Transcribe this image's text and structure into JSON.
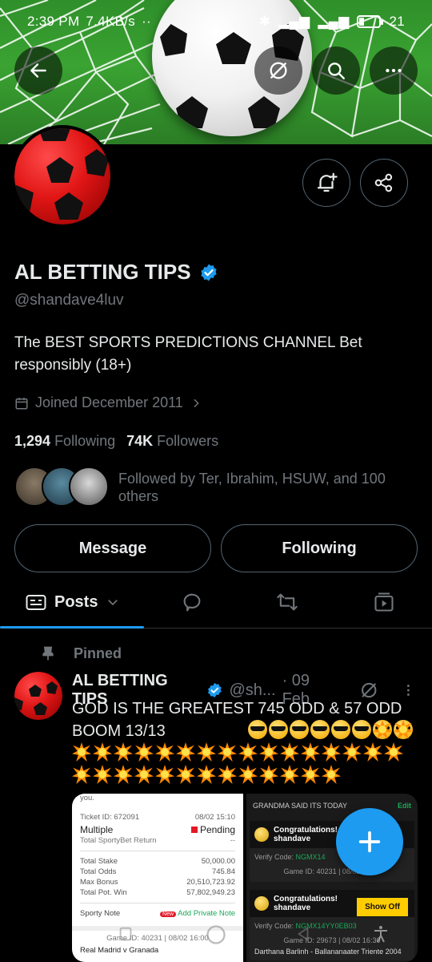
{
  "status_bar": {
    "time": "2:39 PM",
    "speed": "7.4KB/s",
    "battery": "21"
  },
  "profile": {
    "display_name": "AL BETTING TIPS",
    "handle": "@shandave4luv",
    "bio": "The BEST SPORTS PREDICTIONS CHANNEL Bet responsibly (18+)",
    "joined": "Joined December 2011",
    "following_count": "1,294",
    "following_label": "Following",
    "followers_count": "74K",
    "followers_label": "Followers",
    "followed_by": "Followed by Ter, Ibrahim, HSUW, and 100 others"
  },
  "actions": {
    "message_label": "Message",
    "following_label": "Following"
  },
  "tabs": {
    "posts_label": "Posts"
  },
  "post": {
    "pinned_label": "Pinned",
    "author": "AL BETTING TIPS",
    "handle": "@sh...",
    "date": "· 09 Feb",
    "text": "GOD IS THE GREATEST 745 ODD & 57 ODD BOOM 13/13"
  },
  "receipt": {
    "top_text": "you.",
    "ticket_id": "Ticket ID: 672091",
    "ticket_time": "08/02 15:10",
    "bet_type": "Multiple",
    "status": "Pending",
    "return_label": "Total SportyBet Return",
    "return_value": "--",
    "stake_label": "Total Stake",
    "stake_value": "50,000.00",
    "odds_label": "Total Odds",
    "odds_value": "745.84",
    "bonus_label": "Max Bonus",
    "bonus_value": "20,510,723.92",
    "potwin_label": "Total Pot. Win",
    "potwin_value": "57,802,949.23",
    "note_label": "Sporty Note",
    "new_badge": "New",
    "add_note": "Add Private Note",
    "game_id": "Game ID: 40231 | 08/02 16:00",
    "match": "Real Madrid v Granada"
  },
  "shot2": {
    "header": "GRANDMA SAID ITS TODAY",
    "edit": "Edit",
    "congrats": "Congratulations!",
    "user": "shandave",
    "verify1": "Verify Code:",
    "code1": "NGMX14",
    "game1": "Game ID: 40231 | 08/02 16:00",
    "showoff": "Show Off",
    "verify2": "Verify Code:",
    "code2": "NGMX14YY0EB03",
    "game2": "Game ID: 29673 | 08/02 16:30",
    "match2": "Darthana Barlinh - Ballananaater Triente 2004"
  },
  "colors": {
    "accent": "#1d9bf0",
    "muted": "#71767b",
    "border": "#536471"
  }
}
